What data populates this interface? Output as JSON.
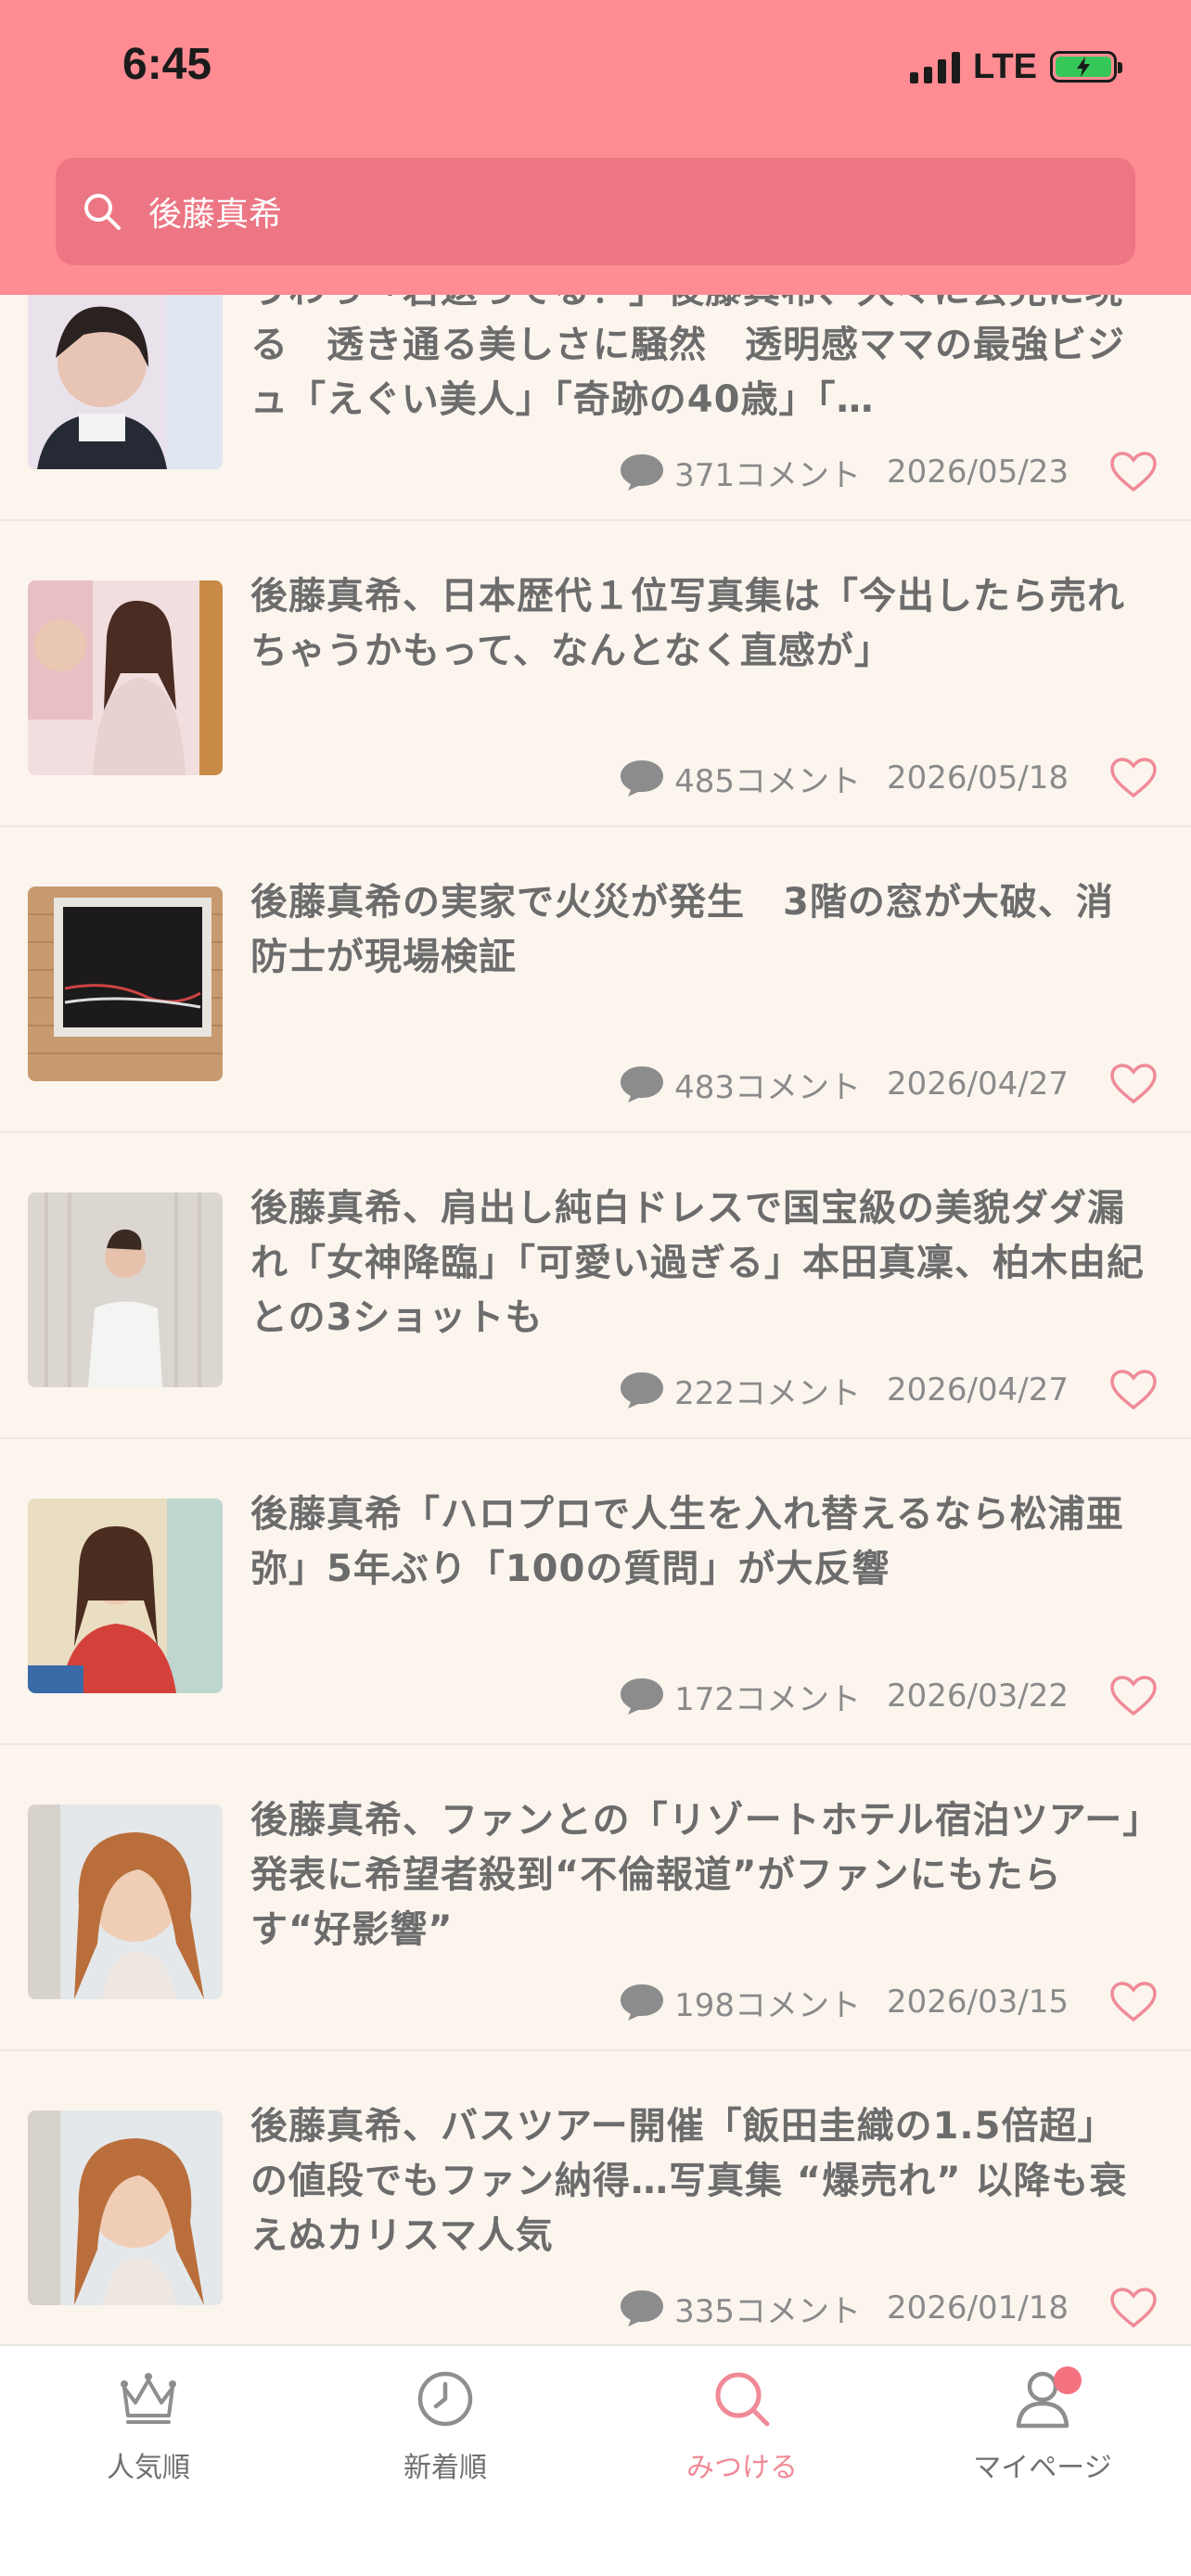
{
  "status_bar": {
    "time": "6:45",
    "network": "LTE"
  },
  "search": {
    "value": "後藤真希",
    "placeholder": ""
  },
  "articles": [
    {
      "title": "うわっ「若返ってる！」後藤真希、久々に会見に現る　透き通る美しさに騒然　透明感ママの最強ビジュ「えぐい美人」「奇跡の40歳」「…",
      "comments": "371コメント",
      "date": "2026/05/23"
    },
    {
      "title": "後藤真希、日本歴代１位写真集は「今出したら売れちゃうかもって、なんとなく直感が」",
      "comments": "485コメント",
      "date": "2026/05/18"
    },
    {
      "title": "後藤真希の実家で火災が発生　3階の窓が大破、消防士が現場検証",
      "comments": "483コメント",
      "date": "2026/04/27"
    },
    {
      "title": "後藤真希、肩出し純白ドレスで国宝級の美貌ダダ漏れ「女神降臨」「可愛い過ぎる」本田真凜、柏木由紀との3ショットも",
      "comments": "222コメント",
      "date": "2026/04/27"
    },
    {
      "title": "後藤真希「ハロプロで人生を入れ替えるなら松浦亜弥」5年ぶり「100の質問」が大反響",
      "comments": "172コメント",
      "date": "2026/03/22"
    },
    {
      "title": "後藤真希、ファンとの「リゾートホテル宿泊ツアー」発表に希望者殺到“不倫報道”がファンにもたらす“好影響”",
      "comments": "198コメント",
      "date": "2026/03/15"
    },
    {
      "title": "後藤真希、バスツアー開催「飯田圭織の1.5倍超」の値段でもファン納得…写真集 “爆売れ” 以降も衰えぬカリスマ人気",
      "comments": "335コメント",
      "date": "2026/01/18"
    }
  ],
  "nav": {
    "popular": "人気順",
    "newest": "新着順",
    "discover": "みつける",
    "mypage": "マイページ"
  },
  "colors": {
    "header": "#ff8c93",
    "search_box": "#ec7683",
    "accent": "#f08a97",
    "badge": "#f4717f",
    "background": "#fbf5ee"
  },
  "icons": {
    "search": "search-icon",
    "comment": "comment-bubble-icon",
    "favorite": "heart-outline-icon",
    "popular": "crown-icon",
    "newest": "clock-icon",
    "discover": "search-icon",
    "mypage": "person-icon"
  }
}
